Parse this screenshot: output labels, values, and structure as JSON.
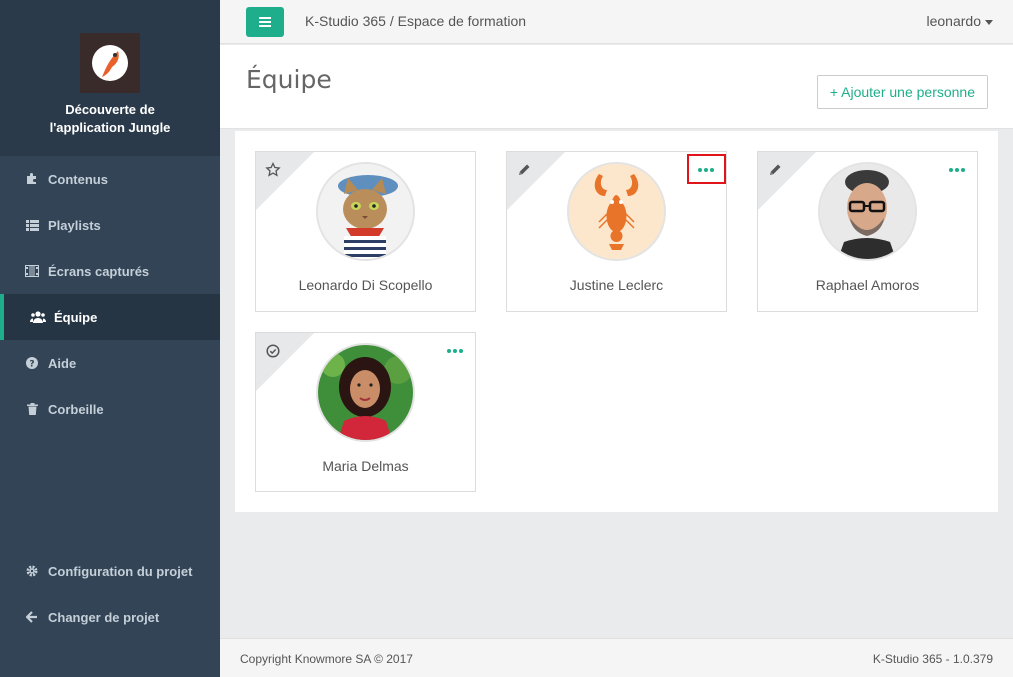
{
  "sidebar": {
    "project_title_line1": "Découverte de",
    "project_title_line2": "l'application Jungle",
    "items": [
      {
        "label": "Contenus",
        "icon": "puzzle-icon"
      },
      {
        "label": "Playlists",
        "icon": "list-icon"
      },
      {
        "label": "Écrans capturés",
        "icon": "film-icon"
      },
      {
        "label": "Équipe",
        "icon": "users-icon",
        "active": true
      },
      {
        "label": "Aide",
        "icon": "question-circle-icon"
      },
      {
        "label": "Corbeille",
        "icon": "trash-icon"
      }
    ],
    "bottom_items": [
      {
        "label": "Configuration du projet",
        "icon": "gear-icon"
      },
      {
        "label": "Changer de projet",
        "icon": "arrow-left-icon"
      }
    ]
  },
  "topbar": {
    "breadcrumb": "K-Studio 365 / Espace de formation",
    "user": "leonardo"
  },
  "page": {
    "title": "Équipe",
    "add_button": "+ Ajouter une personne"
  },
  "members": [
    {
      "name": "Leonardo Di Scopello",
      "corner_icon": "star-icon",
      "has_menu": false
    },
    {
      "name": "Justine Leclerc",
      "corner_icon": "pencil-icon",
      "has_menu": true,
      "highlighted": true
    },
    {
      "name": "Raphael Amoros",
      "corner_icon": "pencil-icon",
      "has_menu": true
    },
    {
      "name": "Maria Delmas",
      "corner_icon": "check-circle-icon",
      "has_menu": true
    }
  ],
  "footer": {
    "copyright": "Copyright Knowmore SA © 2017",
    "version": "K-Studio 365 - 1.0.379"
  },
  "colors": {
    "accent": "#1fae8b",
    "sidebar_bg": "#324456",
    "highlight": "#e0141b"
  }
}
